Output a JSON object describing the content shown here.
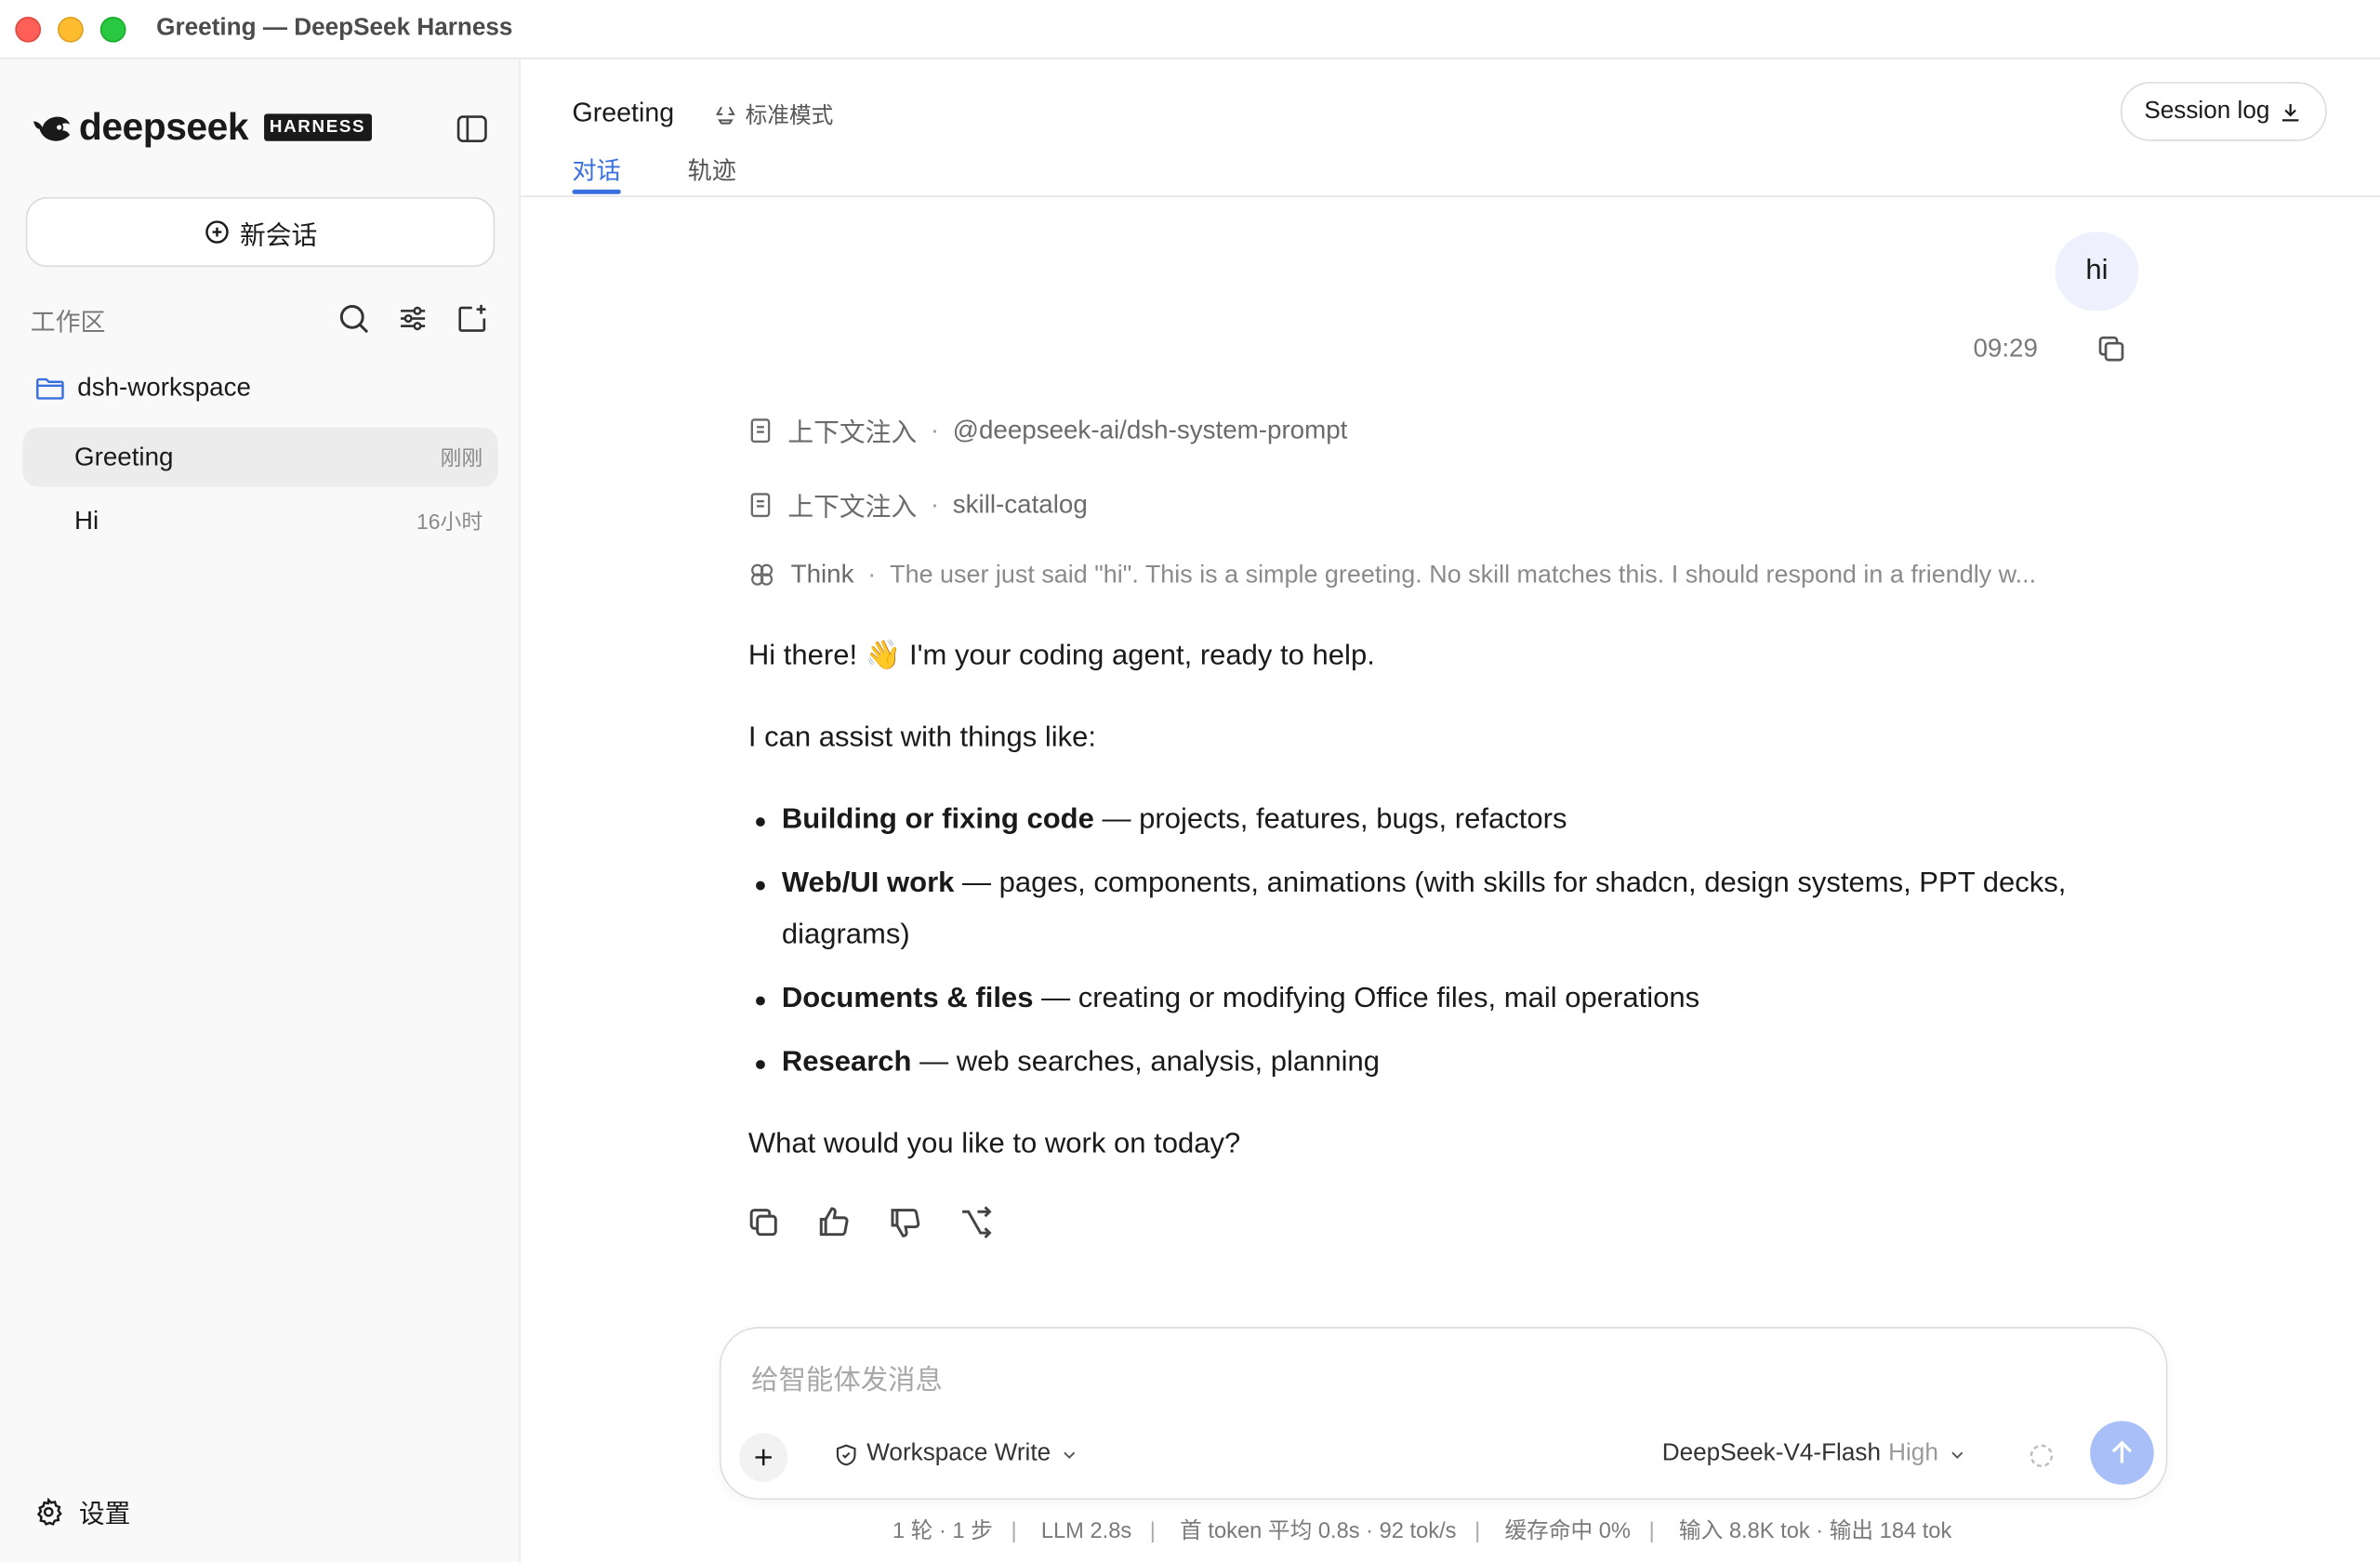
{
  "window": {
    "title": "Greeting — DeepSeek Harness"
  },
  "sidebar": {
    "logo_text": "deepseek",
    "logo_badge": "HARNESS",
    "new_chat_label": "新会话",
    "workspace_label": "工作区",
    "folder": "dsh-workspace",
    "sessions": [
      {
        "title": "Greeting",
        "time": "刚刚",
        "active": true
      },
      {
        "title": "Hi",
        "time": "16小时",
        "active": false
      }
    ],
    "settings_label": "设置"
  },
  "header": {
    "title": "Greeting",
    "mode": "标准模式",
    "tabs": [
      {
        "label": "对话",
        "active": true
      },
      {
        "label": "轨迹",
        "active": false
      }
    ],
    "session_log_label": "Session log"
  },
  "conversation": {
    "user_message": "hi",
    "user_time": "09:29",
    "context_items": [
      {
        "label": "上下文注入",
        "detail": "@deepseek-ai/dsh-system-prompt"
      },
      {
        "label": "上下文注入",
        "detail": "skill-catalog"
      }
    ],
    "think": {
      "label": "Think",
      "text": "The user just said \"hi\". This is a simple greeting. No skill matches this. I should respond in a friendly w..."
    },
    "answer": {
      "greeting": "Hi there! 👋 I'm your coding agent, ready to help.",
      "intro": "I can assist with things like:",
      "items": [
        {
          "bold": "Building or fixing code",
          "text": " — projects, features, bugs, refactors"
        },
        {
          "bold": "Web/UI work",
          "text": " — pages, components, animations (with skills for shadcn, design systems, PPT decks, diagrams)"
        },
        {
          "bold": "Documents & files",
          "text": " — creating or modifying Office files, mail operations"
        },
        {
          "bold": "Research",
          "text": " — web searches, analysis, planning"
        }
      ],
      "closing": "What would you like to work on today?"
    }
  },
  "composer": {
    "placeholder": "给智能体发消息",
    "permission": "Workspace Write",
    "model": "DeepSeek-V4-Flash",
    "level": "High"
  },
  "stats": {
    "turns": "1 轮 · 1 步",
    "llm": "LLM 2.8s",
    "first_token": "首 token 平均 0.8s · 92 tok/s",
    "cache": "缓存命中 0%",
    "io": "输入 8.8K tok · 输出 184 tok"
  },
  "colors": {
    "accent": "#3a6fe0",
    "bubble": "#eef1fd",
    "send": "#a9bff7"
  }
}
